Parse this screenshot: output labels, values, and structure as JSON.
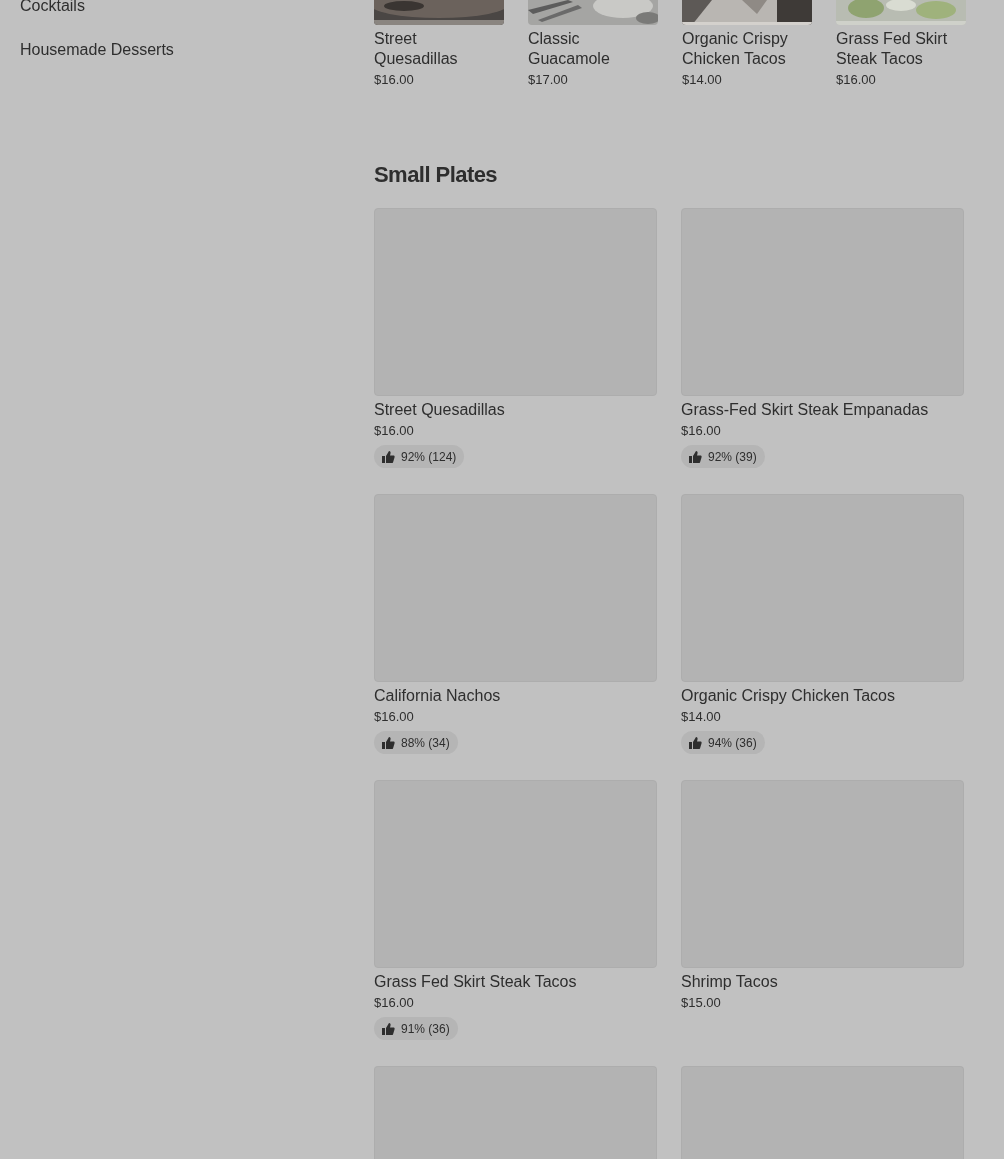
{
  "sidebar": {
    "items": [
      "Cocktails",
      "Housemade Desserts"
    ]
  },
  "featured_items": [
    {
      "name": "Street Quesadillas",
      "price": "$16.00"
    },
    {
      "name": "Classic Guacamole",
      "price": "$17.00"
    },
    {
      "name": "Organic Crispy Chicken Tacos",
      "price": "$14.00"
    },
    {
      "name": "Grass Fed Skirt Steak Tacos",
      "price": "$16.00"
    }
  ],
  "section": {
    "title": "Small Plates",
    "items": [
      {
        "kind": "item",
        "name": "Street Quesadillas",
        "price": "$16.00",
        "rating": "92% (124)"
      },
      {
        "kind": "item",
        "name": "Grass-Fed Skirt Steak Empanadas",
        "price": "$16.00",
        "rating": "92% (39)"
      },
      {
        "kind": "item",
        "name": "California Nachos",
        "price": "$16.00",
        "rating": "88% (34)"
      },
      {
        "kind": "item",
        "name": "Organic Crispy Chicken Tacos",
        "price": "$14.00",
        "rating": "94% (36)"
      },
      {
        "kind": "item",
        "name": "Grass Fed Skirt Steak Tacos",
        "price": "$16.00",
        "rating": "91% (36)"
      },
      {
        "kind": "item",
        "name": "Shrimp Tacos",
        "price": "$15.00"
      },
      {
        "kind": "image_only"
      },
      {
        "kind": "image_only"
      }
    ]
  }
}
